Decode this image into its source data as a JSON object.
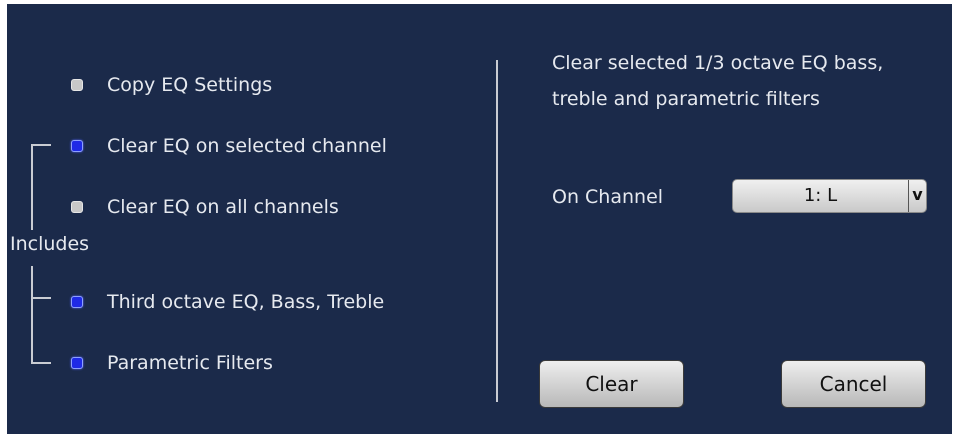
{
  "options": {
    "copy_eq": {
      "label": "Copy EQ Settings",
      "selected": false
    },
    "clear_selected": {
      "label": "Clear EQ on selected channel",
      "selected": true
    },
    "clear_all": {
      "label": "Clear EQ on all channels",
      "selected": false
    }
  },
  "includes": {
    "label": "Includes",
    "third_octave": {
      "label": "Third octave EQ, Bass, Treble",
      "selected": true
    },
    "parametric": {
      "label": "Parametric Filters",
      "selected": true
    }
  },
  "description": {
    "line1": "Clear selected 1/3 octave EQ bass,",
    "line2": "treble and parametric filters"
  },
  "channel": {
    "label": "On Channel",
    "value": "1: L",
    "arrow": "v"
  },
  "buttons": {
    "clear": "Clear",
    "cancel": "Cancel"
  },
  "colors": {
    "background": "#1b2a4a",
    "radio_selected": "#1f2ae6",
    "radio_unselected": "#c8c8c8",
    "text": "#e6e9ef"
  }
}
